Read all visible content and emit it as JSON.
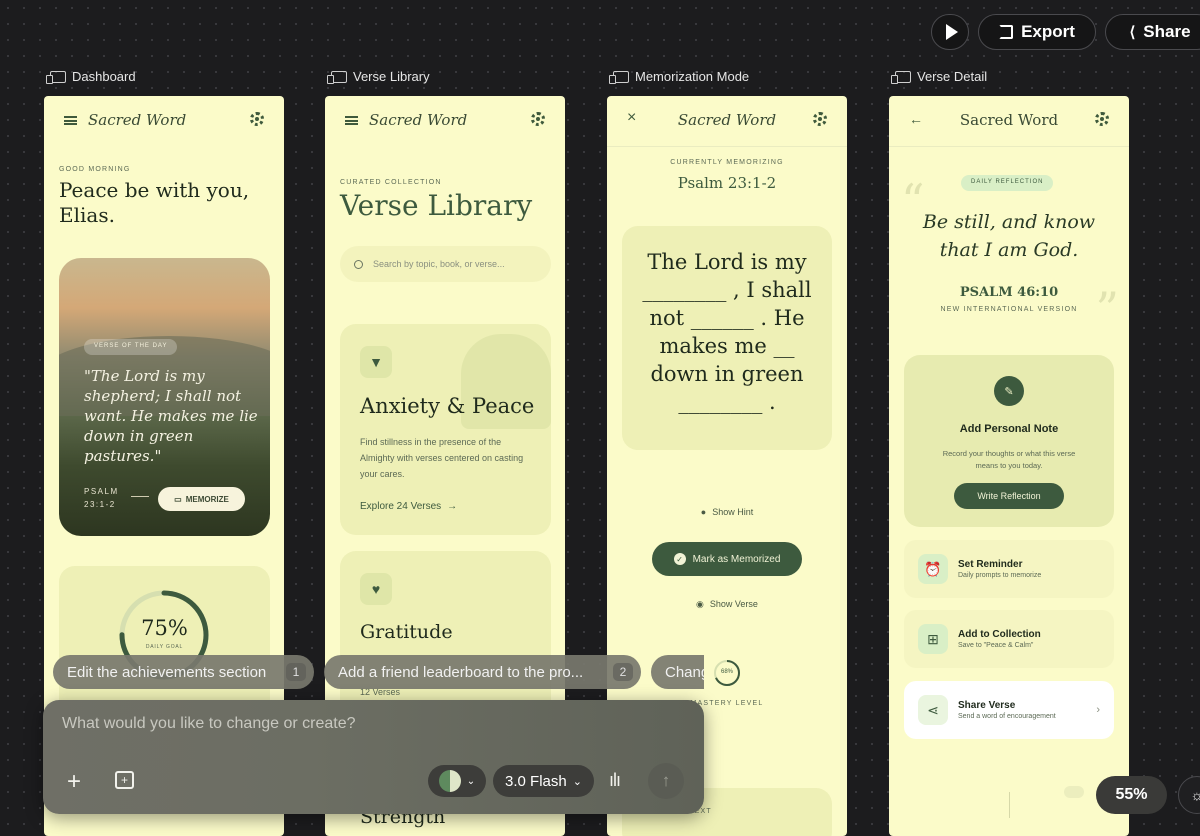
{
  "topbar": {
    "export_label": "Export",
    "share_label": "Share"
  },
  "frames": [
    {
      "label": "Dashboard"
    },
    {
      "label": "Verse Library"
    },
    {
      "label": "Memorization Mode"
    },
    {
      "label": "Verse Detail"
    }
  ],
  "dashboard": {
    "app_title": "Sacred Word",
    "greeting_eyebrow": "GOOD MORNING",
    "greeting": "Peace be with you, Elias.",
    "hero_tag": "VERSE OF THE DAY",
    "hero_quote": "\"The Lord is my shepherd; I shall not want. He makes me lie down in green pastures.\"",
    "hero_ref": "PSALM 23:1-2",
    "memorize_label": "MEMORIZE",
    "goal_percent": "75%",
    "goal_progress": 0.75,
    "goal_label": "DAILY GOAL"
  },
  "library": {
    "app_title": "Sacred Word",
    "eyebrow": "CURATED COLLECTION",
    "title": "Verse Library",
    "search_placeholder": "Search by topic, book, or verse...",
    "card1_title": "Anxiety & Peace",
    "card1_desc": "Find stillness in the presence of the Almighty with verses centered on casting your cares.",
    "card1_link": "Explore 24 Verses",
    "card2_title": "Gratitude",
    "card2_count": "12 Verses",
    "card3_title": "Strength"
  },
  "memorization": {
    "app_title": "Sacred Word",
    "eyebrow": "CURRENTLY MEMORIZING",
    "reference": "Psalm 23:1-2",
    "verse_line1": "The Lord is my",
    "verse_line2": "________ , I shall",
    "verse_line3": "not  ______ . He",
    "verse_line4": "makes me  __",
    "verse_line5": "down in green",
    "verse_line6": "________ .",
    "hint_label": "Show Hint",
    "mark_label": "Mark as Memorized",
    "show_verse_label": "Show Verse",
    "mastery_percent": "68%",
    "mastery_progress": 0.68,
    "mastery_label": "MASTERY LEVEL",
    "context_label": "CONTEXT"
  },
  "detail": {
    "app_title": "Sacred Word",
    "tag": "DAILY REFLECTION",
    "quote": "Be still, and know that I am God.",
    "reference": "PSALM 46:10",
    "version": "NEW INTERNATIONAL VERSION",
    "note_title": "Add Personal Note",
    "note_desc": "Record your thoughts or what this verse means to you today.",
    "note_button": "Write Reflection",
    "reminder_title": "Set Reminder",
    "reminder_sub": "Daily prompts to memorize",
    "collection_title": "Add to Collection",
    "collection_sub": "Save to \"Peace & Calm\"",
    "share_title": "Share Verse",
    "share_sub": "Send a word of encouragement"
  },
  "chips": [
    {
      "label": "Edit the achievements section",
      "num": "1"
    },
    {
      "label": "Add a friend leaderboard to the pro...",
      "num": "2"
    },
    {
      "label": "Chang"
    }
  ],
  "composer": {
    "placeholder": "What would you like to change or create?",
    "model_label": "3.0 Flash"
  },
  "zoom": "55%",
  "colors": {
    "canvas": "#1c1c1e",
    "phone_bg": "#fbfbc9",
    "accent_green": "#3d5a3e"
  }
}
